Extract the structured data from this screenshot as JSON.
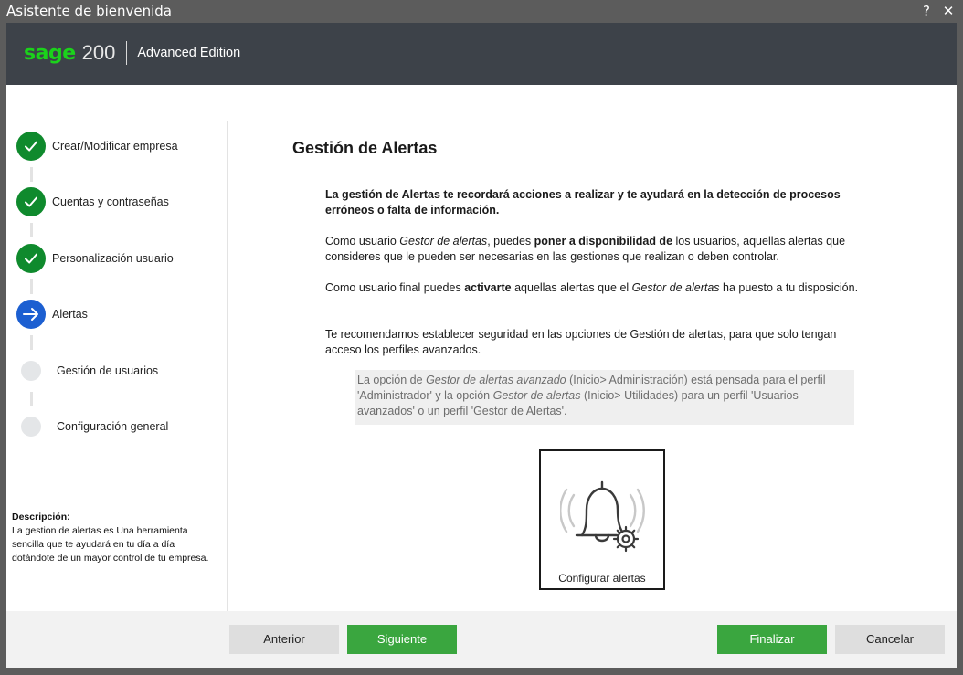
{
  "window": {
    "title": "Asistente de bienvenida",
    "help_label": "?",
    "close_label": "✕"
  },
  "header": {
    "brand": "sage",
    "product_number": "200",
    "edition": "Advanced Edition",
    "brand_color": "#1bd21b"
  },
  "sidebar": {
    "steps": [
      {
        "label": "Crear/Modificar empresa",
        "status": "done"
      },
      {
        "label": "Cuentas y contraseñas",
        "status": "done"
      },
      {
        "label": "Personalización usuario",
        "status": "done"
      },
      {
        "label": "Alertas",
        "status": "current"
      },
      {
        "label": "Gestión de usuarios",
        "status": "pending"
      },
      {
        "label": "Configuración general",
        "status": "pending"
      }
    ],
    "description_title": "Descripción:",
    "description_text": "La gestion de alertas es Una herramienta sencilla que te ayudará en tu día a día dotándote de un mayor control de tu empresa."
  },
  "main": {
    "title": "Gestión de Alertas",
    "p1": "La gestión de Alertas te recordará acciones a realizar y te ayudará en la detección de procesos erróneos o falta de información.",
    "p2": {
      "a": "Como usuario ",
      "b_italic": "Gestor de alertas",
      "c": ", puedes ",
      "d_bold": "poner a disponibilidad de",
      "e": " los usuarios, aquellas alertas que consideres que le pueden ser necesarias en las gestiones que realizan o deben controlar."
    },
    "p3": {
      "a": "Como usuario final puedes ",
      "b_bold": "activarte",
      "c": " aquellas alertas que el ",
      "d_italic": "Gestor de alertas",
      "e": " ha puesto a tu disposición."
    },
    "p4": "Te recomendamos establecer seguridad en las opciones de Gestión de alertas, para que solo tengan acceso los perfiles avanzados.",
    "note": {
      "a": "La opción de ",
      "b_italic": "Gestor de alertas avanzado",
      "c": " (Inicio> Administración) está pensada para el perfil 'Administrador' y la opción ",
      "d_italic": "Gestor de alertas",
      "e": " (Inicio> Utilidades) para un perfil 'Usuarios avanzados' o un perfil 'Gestor de Alertas'."
    },
    "config_card": {
      "label": "Configurar alertas",
      "icon": "bell-gear-icon"
    }
  },
  "footer": {
    "anterior": "Anterior",
    "siguiente": "Siguiente",
    "finalizar": "Finalizar",
    "cancelar": "Cancelar",
    "primary_color": "#3aa63f"
  }
}
